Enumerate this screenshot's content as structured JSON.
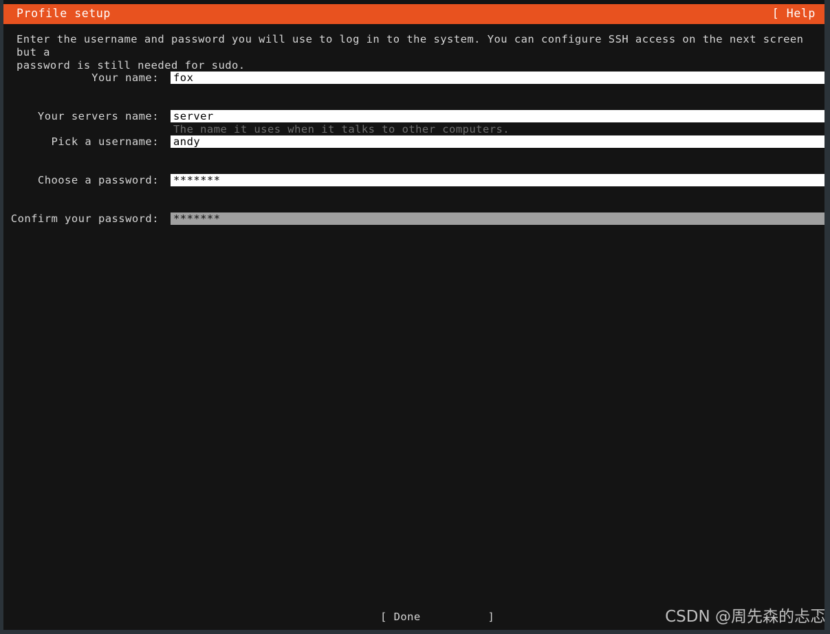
{
  "header": {
    "title": "Profile setup",
    "help_label": "[ Help ]"
  },
  "intro": {
    "text": "Enter the username and password you will use to log in to the system. You can configure SSH access on the next screen but a\npassword is still needed for sudo."
  },
  "form": {
    "fields": [
      {
        "label": "Your name:",
        "value": "fox",
        "hint": "",
        "focused": false
      },
      {
        "label": "Your servers name:",
        "value": "server",
        "hint": "The name it uses when it talks to other computers.",
        "focused": false
      },
      {
        "label": "Pick a username:",
        "value": "andy",
        "hint": "",
        "focused": false
      },
      {
        "label": "Choose a password:",
        "value": "*******",
        "hint": "",
        "focused": false
      },
      {
        "label": "Confirm your password:",
        "value": "*******",
        "hint": "",
        "focused": true
      }
    ]
  },
  "footer": {
    "done_label": "[ Done          ]",
    "watermark": "CSDN @周先森的忐忑"
  },
  "colors": {
    "accent_orange": "#e8521f",
    "screen_background": "#141414",
    "frame_border": "#2b3339",
    "text_primary": "#d6d6d6",
    "text_hint": "#6f6f6f",
    "input_background": "#ffffff",
    "input_focused_background": "#a0a0a0"
  }
}
